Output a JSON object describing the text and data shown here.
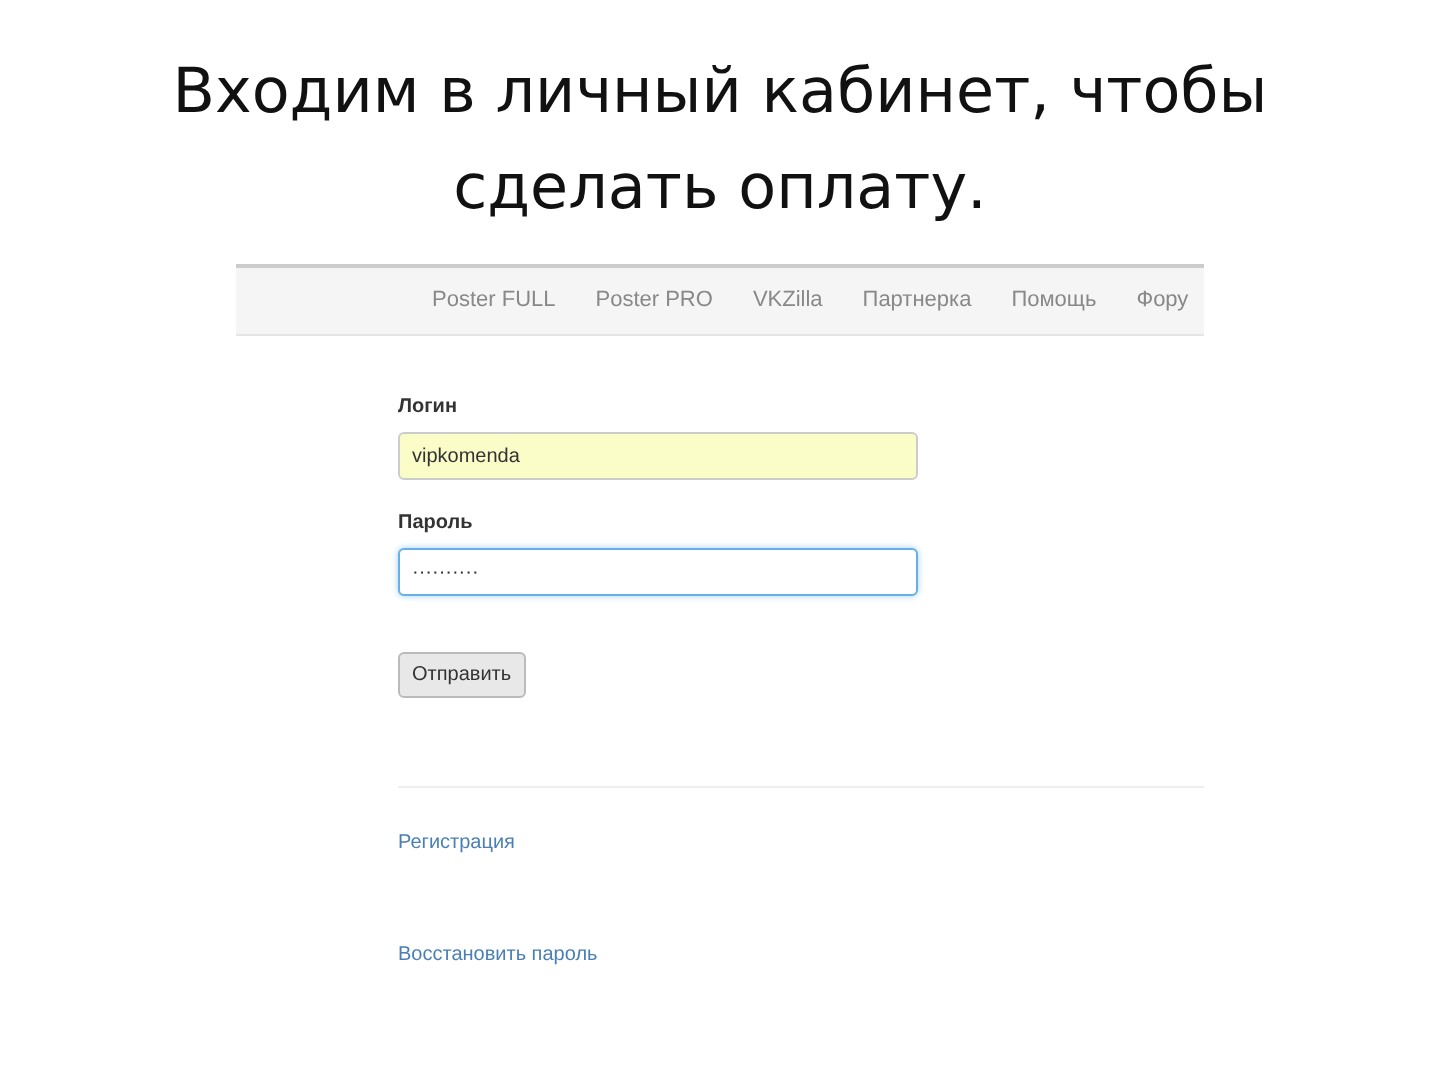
{
  "slide_title": "Входим в личный кабинет, чтобы сделать оплату.",
  "nav": {
    "items": [
      "Poster FULL",
      "Poster PRO",
      "VKZilla",
      "Партнерка",
      "Помощь",
      "Фору"
    ]
  },
  "form": {
    "fields": [
      {
        "label": "Логин",
        "value": "vipkomenda",
        "kind": "autofill"
      },
      {
        "label": "Пароль",
        "value": "··········",
        "kind": "focused"
      }
    ],
    "submit": "Отправить"
  },
  "links": [
    "Регистрация",
    "Восстановить пароль"
  ]
}
